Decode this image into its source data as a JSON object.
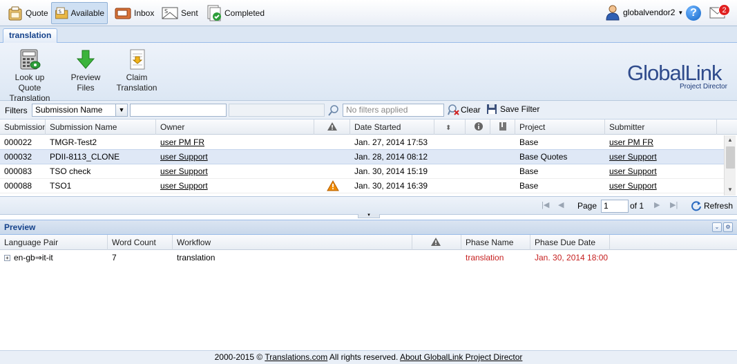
{
  "nav": {
    "items": [
      {
        "label": "Quote",
        "icon": "quote-icon"
      },
      {
        "label": "Available",
        "icon": "available-icon",
        "active": true
      },
      {
        "label": "Inbox",
        "icon": "inbox-icon"
      },
      {
        "label": "Sent",
        "icon": "sent-icon"
      },
      {
        "label": "Completed",
        "icon": "completed-icon"
      }
    ],
    "user": "globalvendor2",
    "help": "?",
    "mail_count": "2"
  },
  "tab": {
    "label": "translation"
  },
  "toolbar": {
    "lookup": [
      "Look up Quote",
      "Translation"
    ],
    "preview": [
      "Preview Files"
    ],
    "claim": [
      "Claim",
      "Translation"
    ],
    "logo_text": "GlobalLink",
    "logo_sub": "Project Director"
  },
  "filters": {
    "label": "Filters",
    "field": "Submission Name",
    "status": "No filters applied",
    "clear": "Clear",
    "save": "Save Filter"
  },
  "grid": {
    "columns": [
      "Submission I",
      "Submission Name",
      "Owner",
      "",
      "Date Started",
      "",
      "",
      "",
      "Project",
      "Submitter"
    ],
    "rows": [
      {
        "id": "000022",
        "name": "TMGR-Test2",
        "owner": "user PM FR",
        "warn": false,
        "date": "Jan. 27, 2014 17:53",
        "project": "Base",
        "submitter": "user PM FR"
      },
      {
        "id": "000032",
        "name": "PDII-8113_CLONE",
        "owner": "user Support",
        "warn": false,
        "date": "Jan. 28, 2014 08:12",
        "project": "Base Quotes",
        "submitter": "user Support"
      },
      {
        "id": "000083",
        "name": "TSO check",
        "owner": "user Support",
        "warn": false,
        "date": "Jan. 30, 2014 15:19",
        "project": "Base",
        "submitter": "user Support"
      },
      {
        "id": "000088",
        "name": "TSO1",
        "owner": "user Support",
        "warn": true,
        "date": "Jan. 30, 2014 16:39",
        "project": "Base",
        "submitter": "user Support"
      }
    ]
  },
  "pager": {
    "page_label": "Page",
    "page": "1",
    "of": "of 1",
    "refresh": "Refresh"
  },
  "preview": {
    "title": "Preview",
    "columns": [
      "Language Pair",
      "Word Count",
      "Workflow",
      "",
      "Phase Name",
      "Phase Due Date"
    ],
    "row": {
      "pair": "en-gb⇒it-it",
      "count": "7",
      "workflow": "translation",
      "phase": "translation",
      "due": "Jan. 30, 2014 18:00"
    }
  },
  "footer": {
    "copy": "2000-2015 © ",
    "company": "Translations.com",
    "rights": " All rights reserved. ",
    "about": "About GlobalLink Project Director"
  },
  "colors": {
    "accent": "#15428b",
    "due_red": "#c62020",
    "warn": "#f08a00"
  }
}
